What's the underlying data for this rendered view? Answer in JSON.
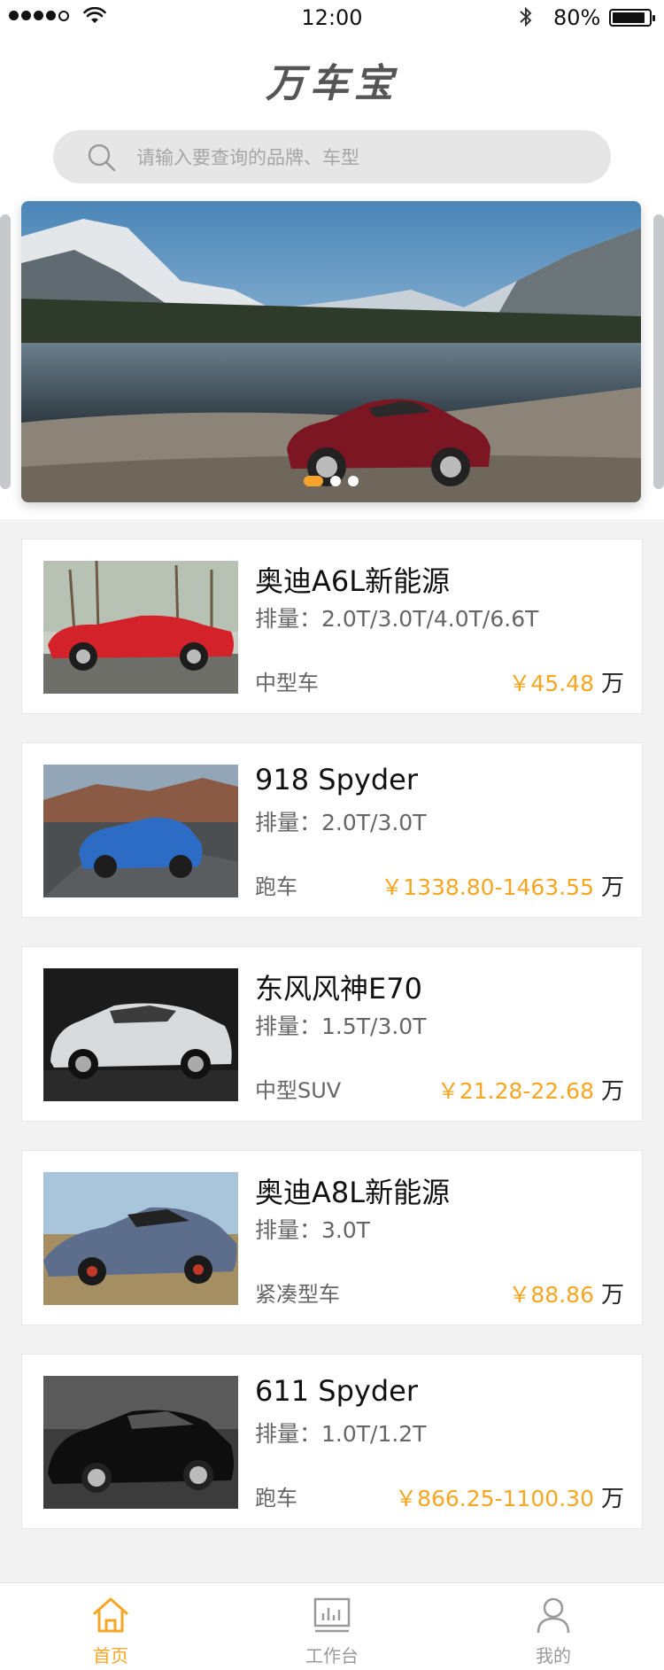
{
  "status_bar": {
    "time": "12:00",
    "battery": "80%"
  },
  "app_title": "万车宝",
  "search": {
    "placeholder": "请输入要查询的品牌、车型"
  },
  "carousel": {
    "slides": 3,
    "active_index": 0
  },
  "cars": [
    {
      "name": "奥迪A6L新能源",
      "displacement": "排量：2.0T/3.0T/4.0T/6.6T",
      "type": "中型车",
      "price": "￥45.48",
      "unit": "万",
      "image": "red-convertible"
    },
    {
      "name": "918 Spyder",
      "displacement": "排量：2.0T/3.0T",
      "type": "跑车",
      "price": "￥1338.80-1463.55",
      "unit": "万",
      "image": "blue-hatchback"
    },
    {
      "name": "东风风神E70",
      "displacement": "排量：1.5T/3.0T",
      "type": "中型SUV",
      "price": "￥21.28-22.68",
      "unit": "万",
      "image": "silver-suv"
    },
    {
      "name": "奥迪A8L新能源",
      "displacement": "排量：3.0T",
      "type": "紧凑型车",
      "price": "￥88.86",
      "unit": "万",
      "image": "supercar"
    },
    {
      "name": "611 Spyder",
      "displacement": "排量：1.0T/1.2T",
      "type": "跑车",
      "price": "￥866.25-1100.30",
      "unit": "万",
      "image": "black-coupe"
    }
  ],
  "tabs": [
    {
      "label": "首页",
      "icon": "home-icon",
      "active": true
    },
    {
      "label": "工作台",
      "icon": "workbench-icon",
      "active": false
    },
    {
      "label": "我的",
      "icon": "profile-icon",
      "active": false
    }
  ],
  "colors": {
    "accent": "#f5a623",
    "background": "#f2f2f2",
    "search_bg": "#e6e6e6"
  }
}
